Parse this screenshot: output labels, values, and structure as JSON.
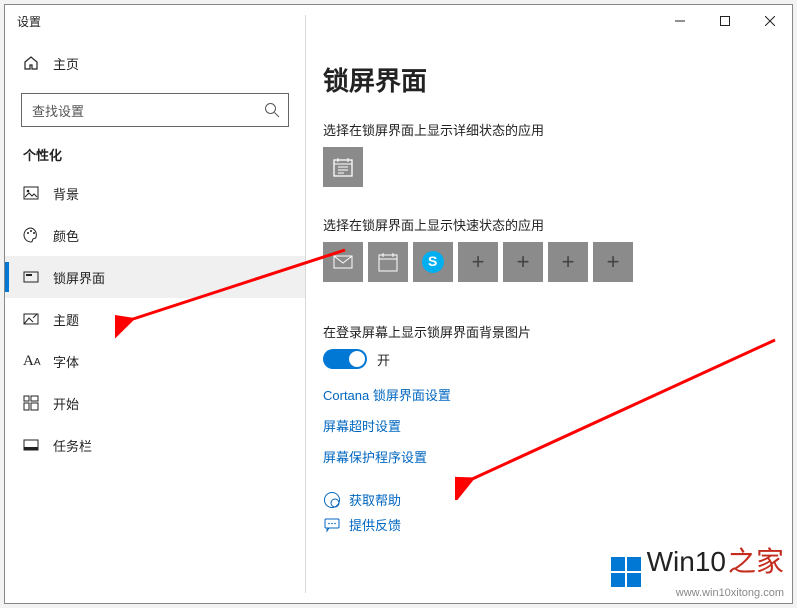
{
  "window": {
    "title": "设置"
  },
  "sidebar": {
    "home_label": "主页",
    "search_placeholder": "查找设置",
    "section_title": "个性化",
    "items": [
      {
        "label": "背景"
      },
      {
        "label": "颜色"
      },
      {
        "label": "锁屏界面"
      },
      {
        "label": "主题"
      },
      {
        "label": "字体"
      },
      {
        "label": "开始"
      },
      {
        "label": "任务栏"
      }
    ]
  },
  "content": {
    "page_title": "锁屏界面",
    "detailed_label": "选择在锁屏界面上显示详细状态的应用",
    "detailed_tile_icon": "calendar-icon",
    "quick_label": "选择在锁屏界面上显示快速状态的应用",
    "quick_tiles": [
      "mail-icon",
      "calendar-icon",
      "skype-icon",
      "add",
      "add",
      "add",
      "add"
    ],
    "signin_label": "在登录屏幕上显示锁屏界面背景图片",
    "signin_toggle_state": "开",
    "link_cortana": "Cortana 锁屏界面设置",
    "link_timeout": "屏幕超时设置",
    "link_screensaver": "屏幕保护程序设置",
    "help_label": "获取帮助",
    "feedback_label": "提供反馈"
  },
  "watermark": {
    "brand1": "Win10",
    "brand2": "之家",
    "url": "www.win10xitong.com"
  }
}
